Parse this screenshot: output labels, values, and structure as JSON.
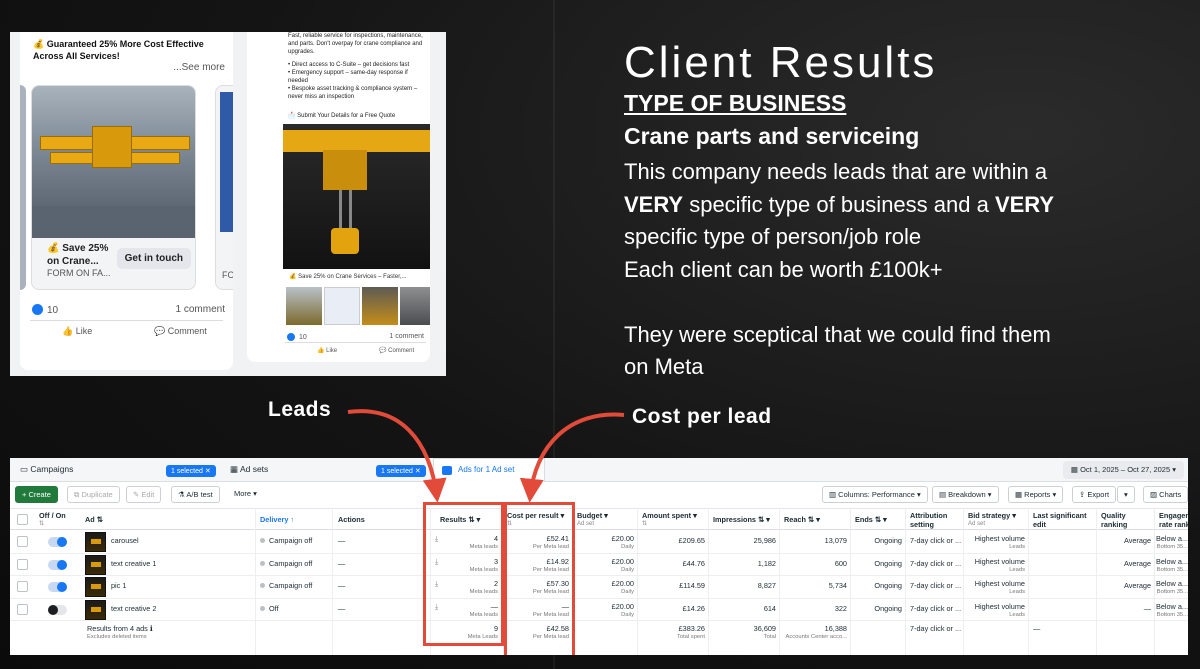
{
  "slide": {
    "title": "Client Results",
    "type_heading": "TYPE OF BUSINESS",
    "business": "Crane parts and serviceing",
    "desc_lines": [
      [
        {
          "t": "This company needs leads that are within a",
          "b": false
        }
      ],
      [
        {
          "t": "VERY",
          "b": true
        },
        {
          "t": " specific type of business and a ",
          "b": false
        },
        {
          "t": "VERY",
          "b": true
        }
      ],
      [
        {
          "t": "specific type of person/job role",
          "b": false
        }
      ],
      [
        {
          "t": "Each client can be worth £100k+",
          "b": false
        }
      ],
      [],
      [
        {
          "t": "They were sceptical that we could find them",
          "b": false
        }
      ],
      [
        {
          "t": "on Meta",
          "b": false
        }
      ]
    ],
    "leads_label": "Leads",
    "cpl_label": "Cost per lead",
    "accent_color": "#e24b3a"
  },
  "ad_preview": {
    "card1": {
      "headline": "💰 Guaranteed 25% More Cost Effective Across All Services!",
      "see_more": "...See more",
      "carousel_caption": "💰 Save 25% on Crane...",
      "cta": "Get in touch",
      "form_label": "FORM ON FA...",
      "next_form_label": "FO",
      "likes": "10",
      "comments": "1 comment",
      "like_btn": "Like",
      "comment_btn": "Comment"
    },
    "card2": {
      "body": "Fast, reliable service for inspections, maintenance, and parts. Don't overpay for crane compliance and upgrades.",
      "bullets": [
        "• Direct access to C-Suite – get decisions fast",
        "• Emergency support – same-day response if needed",
        "• Bespoke asset tracking & compliance system – never miss an inspection"
      ],
      "submit": "📩 Submit Your Details for a Free Quote",
      "caption": "💰 Save 25% on Crane Services – Faster,...",
      "likes": "10",
      "comments": "1 comment",
      "like_btn": "Like",
      "comment_btn": "Comment"
    }
  },
  "ads_manager": {
    "breadcrumb": {
      "campaigns": "Campaigns",
      "adsets": "Ad sets",
      "ads_tab": "Ads for 1 Ad set"
    },
    "selected_badge": "1 selected",
    "date_range": "Oct 1, 2025 – Oct 27, 2025",
    "toolbar": {
      "create": "+ Create",
      "duplicate": "Duplicate",
      "edit": "Edit",
      "ab_test": "A/B test",
      "more": "More",
      "columns": "Columns: Performance",
      "breakdown": "Breakdown",
      "reports": "Reports",
      "export": "Export",
      "charts": "Charts"
    },
    "headers": {
      "onoff": "Off / On",
      "ad": "Ad",
      "delivery": "Delivery ↑",
      "actions": "Actions",
      "results": "Results",
      "cpr": "Cost per result",
      "budget": "Budget",
      "budget_sub": "Ad set",
      "amount": "Amount spent",
      "impressions": "Impressions",
      "reach": "Reach",
      "ends": "Ends",
      "attribution": "Attribution setting",
      "bid": "Bid strategy",
      "bid_sub": "Ad set",
      "lastedit": "Last significant edit",
      "quality": "Quality ranking",
      "engagement": "Engagement rate ranking"
    },
    "rows": [
      {
        "name": "carousel",
        "on": true,
        "delivery": "Campaign off",
        "actions": "—",
        "results": "4",
        "results_sub": "Meta leads",
        "cpr": "£52.41",
        "cpr_sub": "Per Meta lead",
        "budget": "£20.00",
        "budget_sub": "Daily",
        "amount": "£209.65",
        "impressions": "25,986",
        "reach": "13,079",
        "ends": "Ongoing",
        "attribution": "7-day click or ...",
        "bid": "Highest volume",
        "bid_sub": "Leads",
        "quality": "Average",
        "engagement": "Below a...",
        "engagement_sub": "Bottom 35..."
      },
      {
        "name": "text creative 1",
        "on": true,
        "delivery": "Campaign off",
        "actions": "—",
        "results": "3",
        "results_sub": "Meta leads",
        "cpr": "£14.92",
        "cpr_sub": "Per Meta lead",
        "budget": "£20.00",
        "budget_sub": "Daily",
        "amount": "£44.76",
        "impressions": "1,182",
        "reach": "600",
        "ends": "Ongoing",
        "attribution": "7-day click or ...",
        "bid": "Highest volume",
        "bid_sub": "Leads",
        "quality": "Average",
        "engagement": "Below a...",
        "engagement_sub": "Bottom 35..."
      },
      {
        "name": "pic 1",
        "on": true,
        "delivery": "Campaign off",
        "actions": "—",
        "results": "2",
        "results_sub": "Meta leads",
        "cpr": "£57.30",
        "cpr_sub": "Per Meta lead",
        "budget": "£20.00",
        "budget_sub": "Daily",
        "amount": "£114.59",
        "impressions": "8,827",
        "reach": "5,734",
        "ends": "Ongoing",
        "attribution": "7-day click or ...",
        "bid": "Highest volume",
        "bid_sub": "Leads",
        "quality": "Average",
        "engagement": "Below a...",
        "engagement_sub": "Bottom 35..."
      },
      {
        "name": "text creative 2",
        "on": false,
        "delivery": "Off",
        "actions": "—",
        "results": "—",
        "results_sub": "Meta leads",
        "cpr": "—",
        "cpr_sub": "Per Meta lead",
        "budget": "£20.00",
        "budget_sub": "Daily",
        "amount": "£14.26",
        "impressions": "614",
        "reach": "322",
        "ends": "Ongoing",
        "attribution": "7-day click or ...",
        "bid": "Highest volume",
        "bid_sub": "Leads",
        "quality": "—",
        "engagement": "Below a...",
        "engagement_sub": "Bottom 35..."
      }
    ],
    "totals": {
      "label": "Results from 4 ads ℹ",
      "label_sub": "Excludes deleted items",
      "results": "9",
      "results_sub": "Meta Leads",
      "cpr": "£42.58",
      "cpr_sub": "Per Meta lead",
      "amount": "£383.26",
      "amount_sub": "Total spent",
      "impressions": "36,609",
      "impressions_sub": "Total",
      "reach": "16,388",
      "reach_sub": "Accounts Center acco...",
      "attribution": "7-day click or ...",
      "lastedit": "—"
    }
  }
}
